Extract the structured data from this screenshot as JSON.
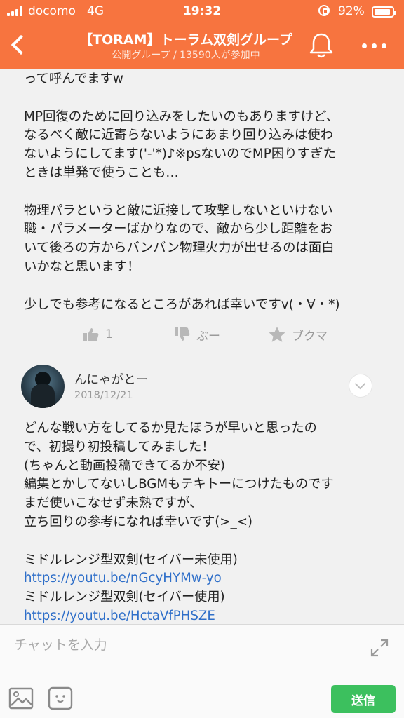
{
  "status_bar": {
    "carrier": "docomo",
    "network": "4G",
    "time": "19:32",
    "battery_percent": "92%",
    "battery_level": 0.92
  },
  "header": {
    "title": "【TORAM】トーラム双剣グループ",
    "subtitle": "公開グループ / 13590人が参加中"
  },
  "post": {
    "lines": "って呼んでますw\n\nMP回復のために回り込みをしたいのもありますけど、\nなるべく敵に近寄らないようにあまり回り込みは使わ\nないようにしてます('-'*)♪※psないのでMP困りすぎた\nときは単発で使うことも…\n\n物理パラというと敵に近接して攻撃しないといけない\n職・パラメーターばかりなので、敵から少し距離をお\nいて後ろの方からバンバン物理火力が出せるのは面白\nいかなと思います！\n\n少しでも参考になるところがあれば幸いですv(・∀・*)",
    "actions": {
      "like_count": "1",
      "boo_label": "ぶー",
      "bookmark_label": "ブクマ"
    }
  },
  "comment": {
    "author": "んにゃがとー",
    "date": "2018/12/21",
    "lines": [
      "どんな戦い方をしてるか見たほうが早いと思ったの",
      "で、初撮り初投稿してみました！",
      "(ちゃんと動画投稿できてるか不安)",
      "編集とかしてないしBGMもテキトーにつけたものです",
      "まだ使いこなせず未熟ですが、",
      "立ち回りの参考になれば幸いです(>_<)",
      "",
      "ミドルレンジ型双剣(セイバー未使用)",
      "https://youtu.be/nGcyHYMw-yo",
      "ミドルレンジ型双剣(セイバー使用)",
      "https://youtu.be/HctaVfPHSZE"
    ]
  },
  "input_bar": {
    "placeholder": "チャットを入力",
    "send_label": "送信"
  },
  "colors": {
    "brand": "#f7743f",
    "link": "#2f6fc9",
    "send": "#3cc05e"
  }
}
